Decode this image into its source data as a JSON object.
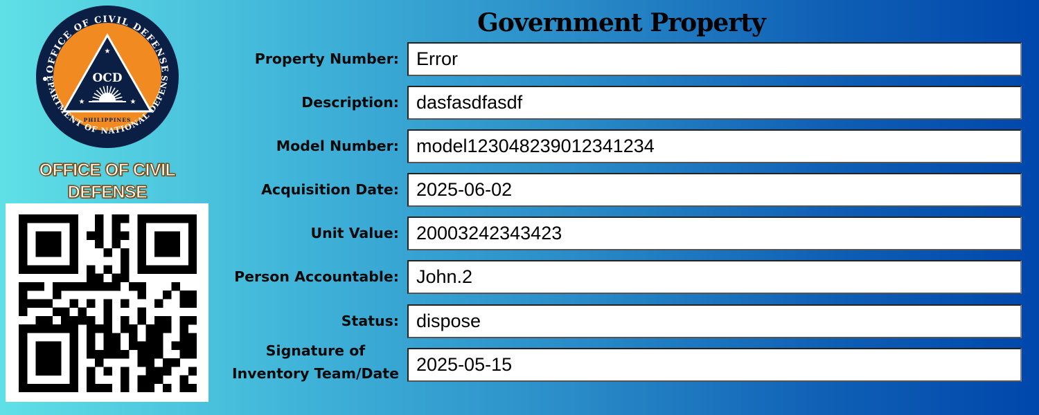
{
  "logo": {
    "top_arc": "OFFICE OF CIVIL DEFENSE",
    "bottom_arc": "DEPARTMENT OF NATIONAL DEFENSE",
    "center": "OCD",
    "country": "PHILIPPINES",
    "colors": {
      "navy": "#0b1f45",
      "orange": "#f28a22"
    }
  },
  "org_name": {
    "line1": "OFFICE OF CIVIL",
    "line2": "DEFENSE"
  },
  "qr_code": {
    "icon": "qr-code"
  },
  "title": "Government Property",
  "fields": [
    {
      "label": "Property Number:",
      "value": "Error"
    },
    {
      "label": "Description:",
      "value": "dasfasdfasdf"
    },
    {
      "label": "Model Number:",
      "value": "model123048239012341234"
    },
    {
      "label": "Acquisition Date:",
      "value": "2025-06-02"
    },
    {
      "label": "Unit Value:",
      "value": "20003242343423"
    },
    {
      "label": "Person Accountable:",
      "value": "John.2"
    },
    {
      "label": "Status:",
      "value": "dispose"
    },
    {
      "label_line1": "Signature of",
      "label_line2": "Inventory Team/Date",
      "value": "2025-05-15"
    }
  ]
}
